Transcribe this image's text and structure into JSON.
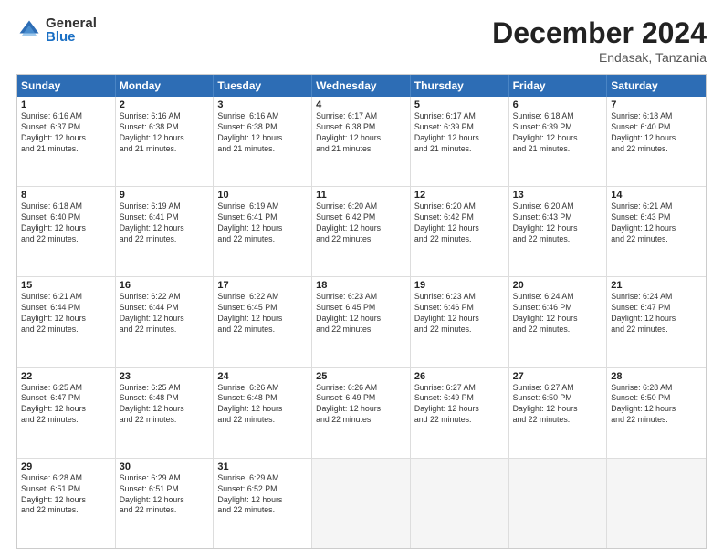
{
  "logo": {
    "general": "General",
    "blue": "Blue"
  },
  "title": {
    "month": "December 2024",
    "location": "Endasak, Tanzania"
  },
  "header_days": [
    "Sunday",
    "Monday",
    "Tuesday",
    "Wednesday",
    "Thursday",
    "Friday",
    "Saturday"
  ],
  "weeks": [
    [
      {
        "day": "1",
        "lines": [
          "Sunrise: 6:16 AM",
          "Sunset: 6:37 PM",
          "Daylight: 12 hours",
          "and 21 minutes."
        ]
      },
      {
        "day": "2",
        "lines": [
          "Sunrise: 6:16 AM",
          "Sunset: 6:38 PM",
          "Daylight: 12 hours",
          "and 21 minutes."
        ]
      },
      {
        "day": "3",
        "lines": [
          "Sunrise: 6:16 AM",
          "Sunset: 6:38 PM",
          "Daylight: 12 hours",
          "and 21 minutes."
        ]
      },
      {
        "day": "4",
        "lines": [
          "Sunrise: 6:17 AM",
          "Sunset: 6:38 PM",
          "Daylight: 12 hours",
          "and 21 minutes."
        ]
      },
      {
        "day": "5",
        "lines": [
          "Sunrise: 6:17 AM",
          "Sunset: 6:39 PM",
          "Daylight: 12 hours",
          "and 21 minutes."
        ]
      },
      {
        "day": "6",
        "lines": [
          "Sunrise: 6:18 AM",
          "Sunset: 6:39 PM",
          "Daylight: 12 hours",
          "and 21 minutes."
        ]
      },
      {
        "day": "7",
        "lines": [
          "Sunrise: 6:18 AM",
          "Sunset: 6:40 PM",
          "Daylight: 12 hours",
          "and 22 minutes."
        ]
      }
    ],
    [
      {
        "day": "8",
        "lines": [
          "Sunrise: 6:18 AM",
          "Sunset: 6:40 PM",
          "Daylight: 12 hours",
          "and 22 minutes."
        ]
      },
      {
        "day": "9",
        "lines": [
          "Sunrise: 6:19 AM",
          "Sunset: 6:41 PM",
          "Daylight: 12 hours",
          "and 22 minutes."
        ]
      },
      {
        "day": "10",
        "lines": [
          "Sunrise: 6:19 AM",
          "Sunset: 6:41 PM",
          "Daylight: 12 hours",
          "and 22 minutes."
        ]
      },
      {
        "day": "11",
        "lines": [
          "Sunrise: 6:20 AM",
          "Sunset: 6:42 PM",
          "Daylight: 12 hours",
          "and 22 minutes."
        ]
      },
      {
        "day": "12",
        "lines": [
          "Sunrise: 6:20 AM",
          "Sunset: 6:42 PM",
          "Daylight: 12 hours",
          "and 22 minutes."
        ]
      },
      {
        "day": "13",
        "lines": [
          "Sunrise: 6:20 AM",
          "Sunset: 6:43 PM",
          "Daylight: 12 hours",
          "and 22 minutes."
        ]
      },
      {
        "day": "14",
        "lines": [
          "Sunrise: 6:21 AM",
          "Sunset: 6:43 PM",
          "Daylight: 12 hours",
          "and 22 minutes."
        ]
      }
    ],
    [
      {
        "day": "15",
        "lines": [
          "Sunrise: 6:21 AM",
          "Sunset: 6:44 PM",
          "Daylight: 12 hours",
          "and 22 minutes."
        ]
      },
      {
        "day": "16",
        "lines": [
          "Sunrise: 6:22 AM",
          "Sunset: 6:44 PM",
          "Daylight: 12 hours",
          "and 22 minutes."
        ]
      },
      {
        "day": "17",
        "lines": [
          "Sunrise: 6:22 AM",
          "Sunset: 6:45 PM",
          "Daylight: 12 hours",
          "and 22 minutes."
        ]
      },
      {
        "day": "18",
        "lines": [
          "Sunrise: 6:23 AM",
          "Sunset: 6:45 PM",
          "Daylight: 12 hours",
          "and 22 minutes."
        ]
      },
      {
        "day": "19",
        "lines": [
          "Sunrise: 6:23 AM",
          "Sunset: 6:46 PM",
          "Daylight: 12 hours",
          "and 22 minutes."
        ]
      },
      {
        "day": "20",
        "lines": [
          "Sunrise: 6:24 AM",
          "Sunset: 6:46 PM",
          "Daylight: 12 hours",
          "and 22 minutes."
        ]
      },
      {
        "day": "21",
        "lines": [
          "Sunrise: 6:24 AM",
          "Sunset: 6:47 PM",
          "Daylight: 12 hours",
          "and 22 minutes."
        ]
      }
    ],
    [
      {
        "day": "22",
        "lines": [
          "Sunrise: 6:25 AM",
          "Sunset: 6:47 PM",
          "Daylight: 12 hours",
          "and 22 minutes."
        ]
      },
      {
        "day": "23",
        "lines": [
          "Sunrise: 6:25 AM",
          "Sunset: 6:48 PM",
          "Daylight: 12 hours",
          "and 22 minutes."
        ]
      },
      {
        "day": "24",
        "lines": [
          "Sunrise: 6:26 AM",
          "Sunset: 6:48 PM",
          "Daylight: 12 hours",
          "and 22 minutes."
        ]
      },
      {
        "day": "25",
        "lines": [
          "Sunrise: 6:26 AM",
          "Sunset: 6:49 PM",
          "Daylight: 12 hours",
          "and 22 minutes."
        ]
      },
      {
        "day": "26",
        "lines": [
          "Sunrise: 6:27 AM",
          "Sunset: 6:49 PM",
          "Daylight: 12 hours",
          "and 22 minutes."
        ]
      },
      {
        "day": "27",
        "lines": [
          "Sunrise: 6:27 AM",
          "Sunset: 6:50 PM",
          "Daylight: 12 hours",
          "and 22 minutes."
        ]
      },
      {
        "day": "28",
        "lines": [
          "Sunrise: 6:28 AM",
          "Sunset: 6:50 PM",
          "Daylight: 12 hours",
          "and 22 minutes."
        ]
      }
    ],
    [
      {
        "day": "29",
        "lines": [
          "Sunrise: 6:28 AM",
          "Sunset: 6:51 PM",
          "Daylight: 12 hours",
          "and 22 minutes."
        ]
      },
      {
        "day": "30",
        "lines": [
          "Sunrise: 6:29 AM",
          "Sunset: 6:51 PM",
          "Daylight: 12 hours",
          "and 22 minutes."
        ]
      },
      {
        "day": "31",
        "lines": [
          "Sunrise: 6:29 AM",
          "Sunset: 6:52 PM",
          "Daylight: 12 hours",
          "and 22 minutes."
        ]
      },
      {
        "day": "",
        "lines": []
      },
      {
        "day": "",
        "lines": []
      },
      {
        "day": "",
        "lines": []
      },
      {
        "day": "",
        "lines": []
      }
    ]
  ]
}
